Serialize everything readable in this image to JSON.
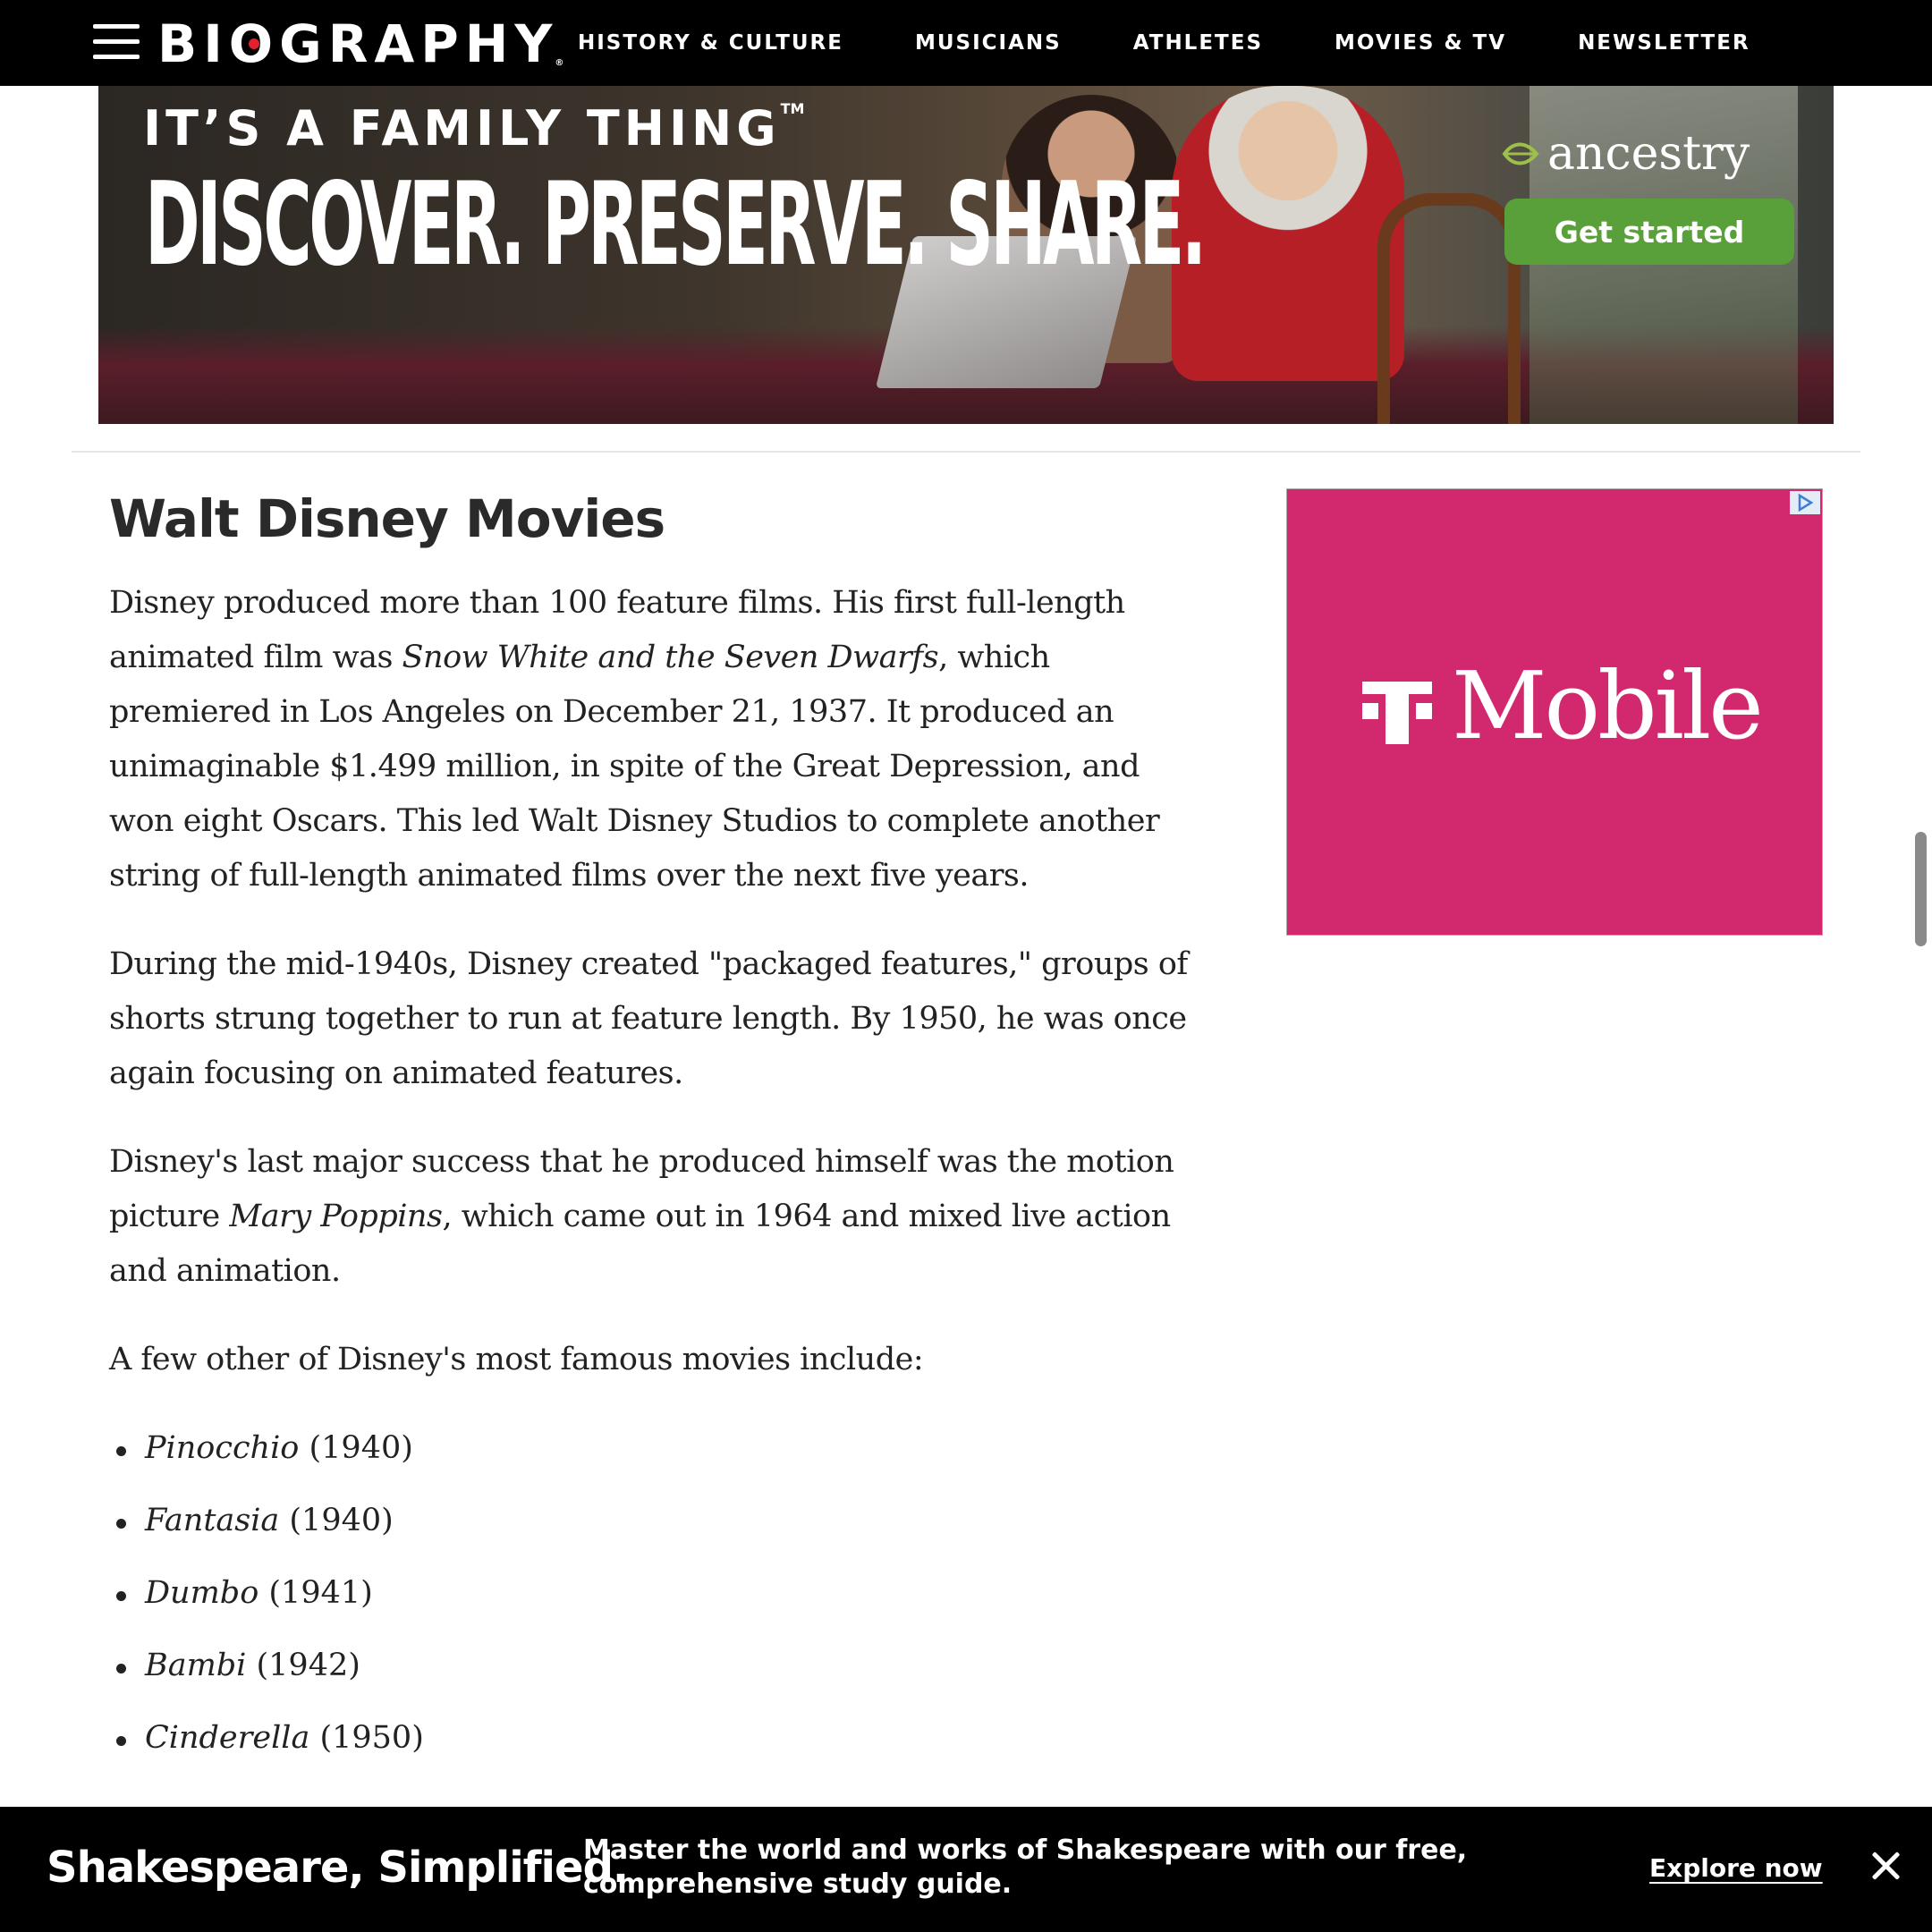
{
  "nav": {
    "logo": "BIOGRAPHY",
    "links": [
      "HISTORY & CULTURE",
      "MUSICIANS",
      "ATHLETES",
      "MOVIES & TV",
      "NEWSLETTER"
    ]
  },
  "banner_ad": {
    "tagline": "IT’S A FAMILY THING",
    "trademark": "TM",
    "headline": "DISCOVER. PRESERVE. SHARE.",
    "brand": "ancestry",
    "cta": "Get started",
    "cta_color": "#5aa03a"
  },
  "article": {
    "heading": "Walt Disney Movies",
    "p1_a": "Disney produced more than 100 feature films. His first full-length animated film was ",
    "p1_title": "Snow White and the Seven Dwarfs",
    "p1_b": ", which premiered in Los Angeles on December 21, 1937. It produced an unimaginable $1.499 million, in spite of the Great Depression, and won eight Oscars. This led Walt Disney Studios to complete another string of full-length animated films over the next five years.",
    "p2": "During the mid-1940s, Disney created \"packaged features,\" groups of shorts strung together to run at feature length. By 1950, he was once again focusing on animated features.",
    "p3_a": "Disney's last major success that he produced himself was the motion picture ",
    "p3_title": "Mary Poppins",
    "p3_b": ", which came out in 1964 and mixed live action and animation.",
    "p4": "A few other of Disney's most famous movies include:",
    "movies": [
      {
        "title": "Pinocchio",
        "year": " (1940)"
      },
      {
        "title": "Fantasia",
        "year": " (1940)"
      },
      {
        "title": "Dumbo",
        "year": " (1941)"
      },
      {
        "title": "Bambi",
        "year": " (1942)"
      },
      {
        "title": "Cinderella",
        "year": " (1950)"
      }
    ]
  },
  "side_ad": {
    "brand": "Mobile",
    "background": "#d2286e"
  },
  "bottom_bar": {
    "title": "Shakespeare, Simplified.",
    "description": "Master the world and works of Shakespeare with our free, comprehensive study guide.",
    "cta": "Explore now"
  }
}
